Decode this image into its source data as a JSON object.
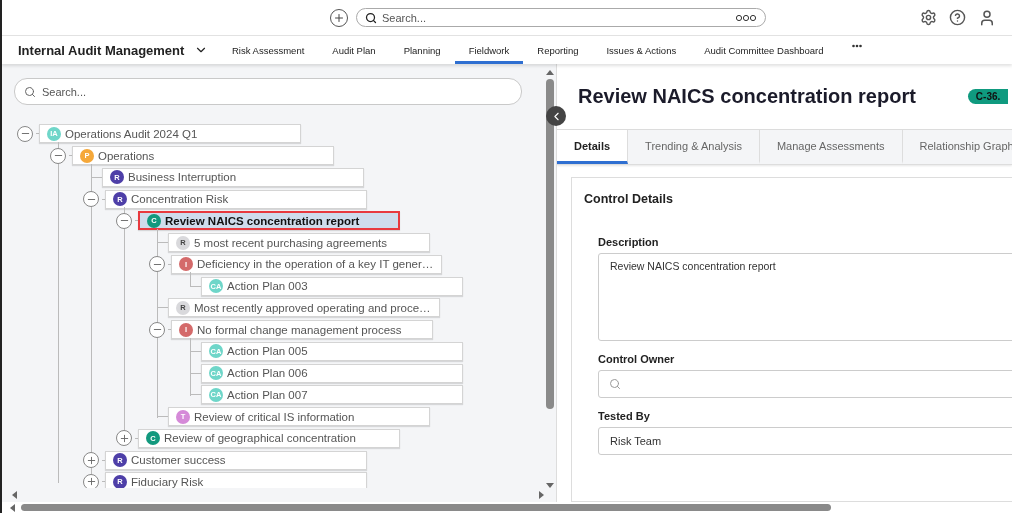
{
  "header": {
    "search_placeholder": "Search..."
  },
  "app_menu": {
    "title": "Internal Audit Management"
  },
  "nav": [
    {
      "label": "Risk Assessment",
      "selected": false
    },
    {
      "label": "Audit Plan",
      "selected": false
    },
    {
      "label": "Planning",
      "selected": false
    },
    {
      "label": "Fieldwork",
      "selected": true
    },
    {
      "label": "Reporting",
      "selected": false
    },
    {
      "label": "Issues & Actions",
      "selected": false
    },
    {
      "label": "Audit Committee Dashboard",
      "selected": false
    }
  ],
  "tree_search": {
    "placeholder": "Search..."
  },
  "tree": [
    {
      "label": "Operations Audit 2024 Q1",
      "badge": "IA",
      "color": "#6fd6c9",
      "expanded": true,
      "selected": false,
      "children": [
        {
          "label": "Operations",
          "badge": "P",
          "color": "#f5a83a",
          "expanded": true,
          "selected": false,
          "children": [
            {
              "label": "Business Interruption",
              "badge": "R",
              "color": "#4e3fa8",
              "selected": false
            },
            {
              "label": "Concentration Risk",
              "badge": "R",
              "color": "#4e3fa8",
              "expanded": true,
              "selected": false,
              "children": [
                {
                  "label": "Review NAICS concentration report",
                  "badge": "C",
                  "color": "#12997e",
                  "expanded": true,
                  "selected": true,
                  "children": [
                    {
                      "label": "5 most recent purchasing agreements",
                      "badge": "R",
                      "color": "#d9d9dc",
                      "selected": false
                    },
                    {
                      "label": "Deficiency in the operation of a key IT gener…",
                      "badge": "I",
                      "color": "#d46a6a",
                      "expanded": true,
                      "selected": false,
                      "children": [
                        {
                          "label": "Action Plan 003",
                          "badge": "CA",
                          "color": "#6fd6c9",
                          "selected": false
                        }
                      ]
                    },
                    {
                      "label": "Most recently approved operating and proce…",
                      "badge": "R",
                      "color": "#d9d9dc",
                      "selected": false
                    },
                    {
                      "label": "No formal change management process",
                      "badge": "I",
                      "color": "#d46a6a",
                      "expanded": true,
                      "selected": false,
                      "children": [
                        {
                          "label": "Action Plan 005",
                          "badge": "CA",
                          "color": "#6fd6c9",
                          "selected": false
                        },
                        {
                          "label": "Action Plan 006",
                          "badge": "CA",
                          "color": "#6fd6c9",
                          "selected": false
                        },
                        {
                          "label": "Action Plan 007",
                          "badge": "CA",
                          "color": "#6fd6c9",
                          "selected": false
                        }
                      ]
                    },
                    {
                      "label": "Review of critical IS information",
                      "badge": "T",
                      "color": "#d58ad8",
                      "selected": false
                    }
                  ]
                },
                {
                  "label": "Review of geographical concentration",
                  "badge": "C",
                  "color": "#12997e",
                  "expanded": false,
                  "selected": false
                }
              ]
            },
            {
              "label": "Customer success",
              "badge": "R",
              "color": "#4e3fa8",
              "expanded": false,
              "selected": false
            },
            {
              "label": "Fiduciary Risk",
              "badge": "R",
              "color": "#4e3fa8",
              "expanded": false,
              "selected": false
            }
          ]
        }
      ]
    }
  ],
  "detail": {
    "title": "Review NAICS concentration report",
    "badge": "C-36.",
    "tabs": [
      {
        "label": "Details",
        "selected": true
      },
      {
        "label": "Trending & Analysis",
        "selected": false
      },
      {
        "label": "Manage Assessments",
        "selected": false
      },
      {
        "label": "Relationship Graph",
        "selected": false
      }
    ],
    "section": "Control Details",
    "fields": [
      {
        "kind": "textarea",
        "label": "Description",
        "value": "Review NAICS concentration report"
      },
      {
        "kind": "search",
        "label": "Control Owner"
      },
      {
        "kind": "text",
        "label": "Tested By",
        "value": "Risk Team"
      }
    ]
  }
}
